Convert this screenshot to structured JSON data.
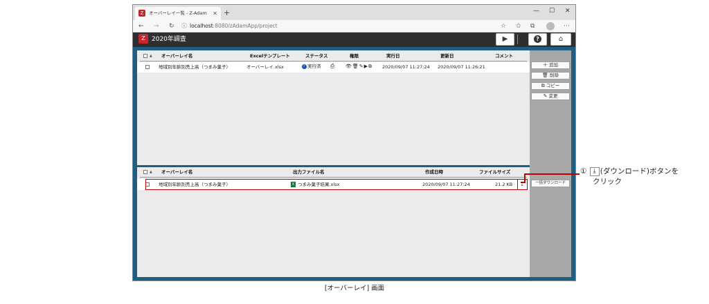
{
  "browser": {
    "tab_title": "オーバーレイ一覧 - Z-Adam",
    "tab_close": "✕",
    "new_tab": "+",
    "url_host": "localhost",
    "url_path": ":8080/zAdamApp/project",
    "minimize": "—",
    "maximize": "☐",
    "close": "✕"
  },
  "app": {
    "title": "2020年調査",
    "logo": "Z"
  },
  "upper_table": {
    "headers": {
      "name": "オーバーレイ名",
      "template": "Excelテンプレート",
      "status": "ステータス",
      "permission": "権限",
      "executed": "実行日",
      "updated": "更新日",
      "comment": "コメント"
    },
    "rows": [
      {
        "name": "地域別年齢別売上高（つまみ菓子）",
        "template": "オーバーレイ.xlsx",
        "status": "実行済",
        "executed": "2020/09/07 11:27:24",
        "updated": "2020/09/07 11:26:21",
        "comment": ""
      }
    ]
  },
  "sidebar_buttons": {
    "add": "追加",
    "delete": "削除",
    "copy": "コピー",
    "edit": "変更",
    "bulk_download": "一括ダウンロード"
  },
  "lower_table": {
    "headers": {
      "name": "オーバーレイ名",
      "output": "出力ファイル名",
      "created": "作成日時",
      "size": "ファイルサイズ"
    },
    "rows": [
      {
        "name": "地域別年齢別売上高（つまみ菓子）",
        "output": "つまみ菓子結果.xlsx",
        "created": "2020/09/07 11:27:24",
        "size": "21.2 KB"
      }
    ]
  },
  "callout": {
    "number": "①",
    "line1_after": "(ダウンロード)ボタンを",
    "line2": "クリック"
  },
  "caption": "[オーバーレイ] 画面",
  "colors": {
    "frame": "#1f5e80",
    "highlight": "#c00000",
    "header_bar": "#2f2f2f",
    "logo": "#c6262e"
  }
}
